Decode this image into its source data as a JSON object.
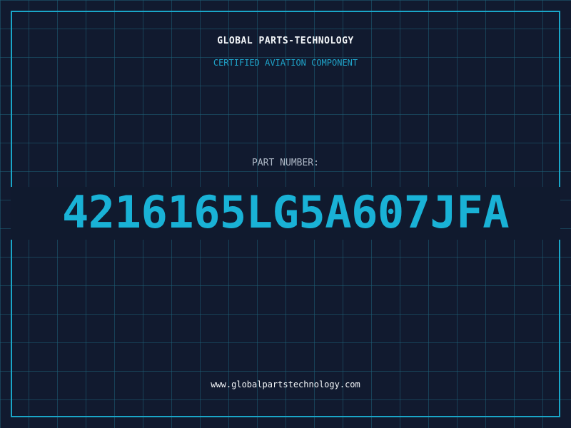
{
  "header": {
    "company": "GLOBAL PARTS-TECHNOLOGY",
    "tagline": "CERTIFIED AVIATION COMPONENT"
  },
  "part": {
    "label": "PART NUMBER:",
    "number": "4216165LG5A607JFA"
  },
  "footer": {
    "website": "www.globalpartstechnology.com"
  },
  "colors": {
    "background": "#111a2f",
    "grid": "#1e6078",
    "frame": "#1aa6c8",
    "accent": "#19b2d6",
    "text_primary": "#f2f5f8",
    "text_muted": "#aeb8c6"
  }
}
